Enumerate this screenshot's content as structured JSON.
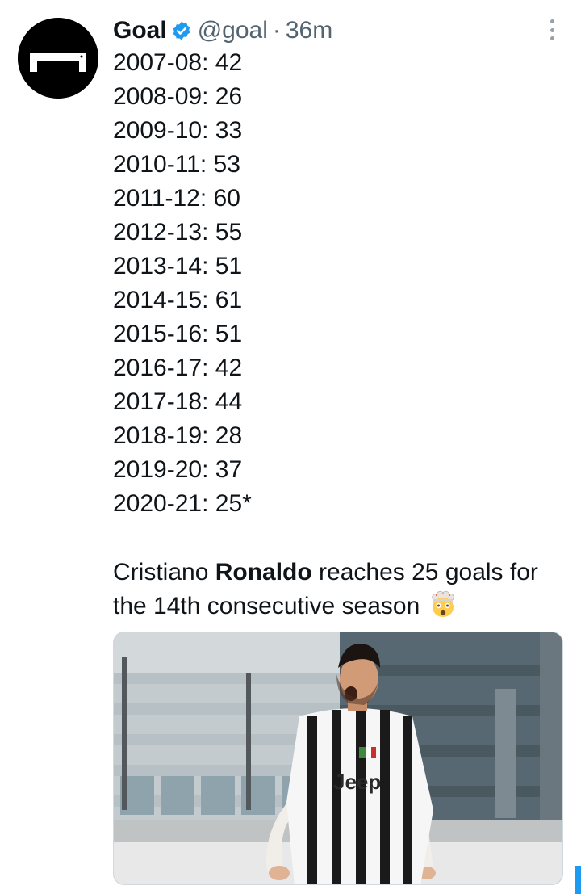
{
  "tweet": {
    "author": {
      "name": "Goal",
      "handle": "@goal",
      "verified": true,
      "avatar_icon": "goal-logo-icon"
    },
    "separator": "·",
    "time": "36m",
    "stats": [
      "2007-08: 42",
      "2008-09: 26",
      "2009-10: 33",
      "2010-11: 53",
      "2011-12: 60",
      "2012-13: 55",
      "2013-14: 51",
      "2014-15: 61",
      "2015-16: 51",
      "2016-17: 42",
      "2017-18: 44",
      "2018-19: 28",
      "2019-20: 37",
      "2020-21: 25*"
    ],
    "caption": {
      "before": "Cristiano ",
      "bold": "Ronaldo",
      "after": " reaches 25 goals for the 14th consecutive season",
      "emoji": "exploding-head-emoji"
    },
    "media": {
      "jersey_sponsor": "Jeep"
    }
  },
  "colors": {
    "text": "#0f1419",
    "secondary": "#536471",
    "verified": "#1d9bf0",
    "accent": "#1d9bf0"
  }
}
